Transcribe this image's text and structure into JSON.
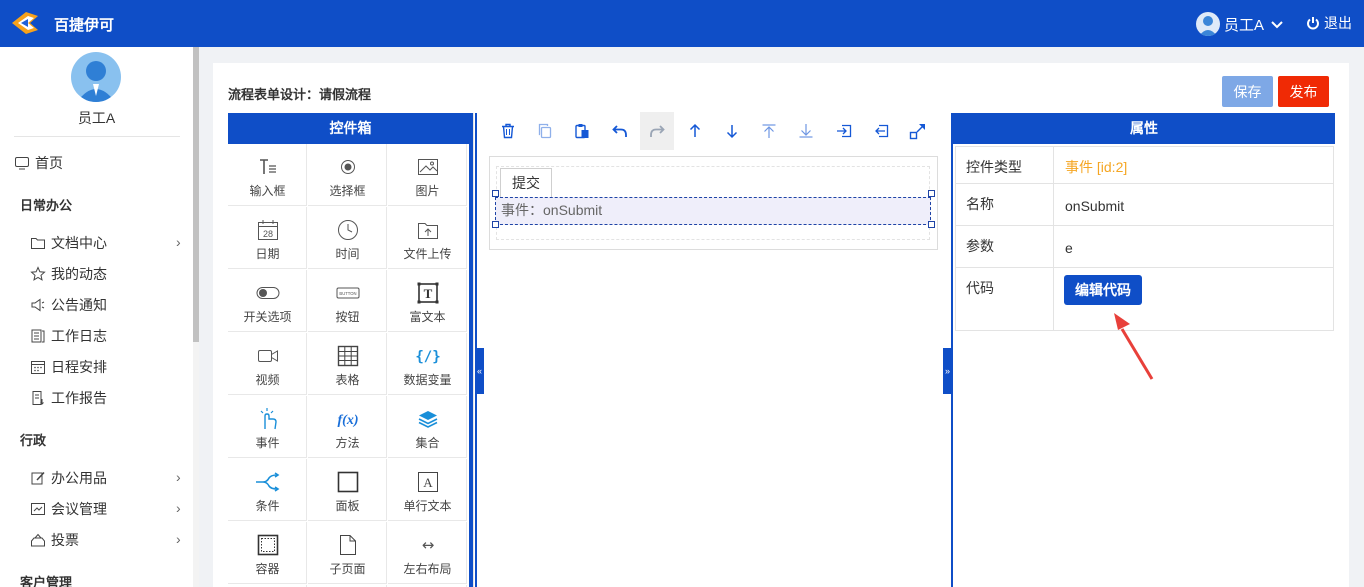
{
  "header": {
    "brand": "百捷伊可",
    "user_name": "员工A",
    "logout_label": "退出"
  },
  "sidebar": {
    "user_name": "员工A",
    "home": "首页",
    "sections": [
      {
        "title": "日常办公",
        "items": [
          "文档中心",
          "我的动态",
          "公告通知",
          "工作日志",
          "日程安排",
          "工作报告"
        ]
      },
      {
        "title": "行政",
        "items": [
          "办公用品",
          "会议管理",
          "投票"
        ]
      },
      {
        "title": "客户管理"
      }
    ]
  },
  "page": {
    "title": "流程表单设计：请假流程",
    "save_label": "保存",
    "publish_label": "发布"
  },
  "toolbox": {
    "title": "控件箱",
    "items": [
      {
        "label": "输入框",
        "icon": "text-input-icon"
      },
      {
        "label": "选择框",
        "icon": "radio-icon"
      },
      {
        "label": "图片",
        "icon": "image-icon"
      },
      {
        "label": "日期",
        "icon": "calendar-icon",
        "glyph": "28"
      },
      {
        "label": "时间",
        "icon": "clock-icon"
      },
      {
        "label": "文件上传",
        "icon": "folder-upload-icon"
      },
      {
        "label": "开关选项",
        "icon": "toggle-icon"
      },
      {
        "label": "按钮",
        "icon": "button-icon",
        "glyph": "BUTTON"
      },
      {
        "label": "富文本",
        "icon": "rich-text-icon",
        "glyph": "T"
      },
      {
        "label": "视频",
        "icon": "video-icon"
      },
      {
        "label": "表格",
        "icon": "table-icon"
      },
      {
        "label": "数据变量",
        "icon": "variable-icon",
        "glyph": "{/}"
      },
      {
        "label": "事件",
        "icon": "pointer-icon"
      },
      {
        "label": "方法",
        "icon": "function-icon",
        "glyph": "f(x)"
      },
      {
        "label": "集合",
        "icon": "layers-icon"
      },
      {
        "label": "条件",
        "icon": "branch-icon"
      },
      {
        "label": "面板",
        "icon": "panel-icon"
      },
      {
        "label": "单行文本",
        "icon": "single-text-icon",
        "glyph": "A"
      },
      {
        "label": "容器",
        "icon": "container-icon"
      },
      {
        "label": "子页面",
        "icon": "subpage-icon"
      },
      {
        "label": "左右布局",
        "icon": "horizontal-layout-icon",
        "glyph": "↔"
      }
    ]
  },
  "canvas": {
    "submit_label": "提交",
    "event_label": "事件：onSubmit",
    "toolbar": [
      "delete-icon",
      "copy-icon",
      "paste-icon",
      "undo-icon",
      "redo-icon",
      "move-up-icon",
      "move-down-icon",
      "move-top-icon",
      "move-bottom-icon",
      "move-in-icon",
      "move-out-icon",
      "expand-icon"
    ]
  },
  "properties": {
    "title": "属性",
    "rows": [
      {
        "key": "控件类型",
        "value": "事件 [id:2]"
      },
      {
        "key": "名称",
        "value": "onSubmit"
      },
      {
        "key": "参数",
        "value": "e"
      },
      {
        "key": "代码",
        "button": "编辑代码"
      }
    ],
    "type_color": "#f5a623"
  },
  "colors": {
    "primary": "#0f4ec7",
    "save": "#7ea8e6",
    "publish": "#f02a05",
    "annotation_arrow": "#e8403a"
  }
}
